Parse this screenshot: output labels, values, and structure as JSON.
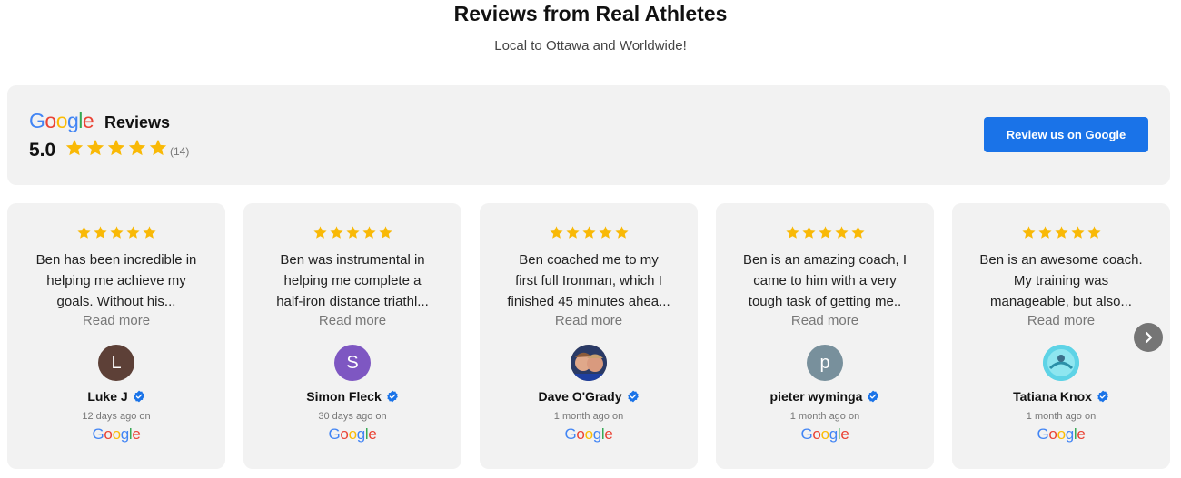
{
  "header": {
    "title": "Reviews from Real Athletes",
    "subtitle": "Local to Ottawa and Worldwide!"
  },
  "summary": {
    "logo_letters": [
      "G",
      "o",
      "o",
      "g",
      "l",
      "e"
    ],
    "reviews_label": "Reviews",
    "rating": "5.0",
    "star_count": 5,
    "review_count": "(14)",
    "button_label": "Review us on Google"
  },
  "colors": {
    "star": "#F9B906",
    "button": "#1a73e8",
    "verified": "#1a73e8",
    "google_blue": "#4285F4",
    "google_red": "#EA4335",
    "google_yellow": "#FBBC05",
    "google_green": "#34A853"
  },
  "reviews": [
    {
      "stars": 5,
      "lines": [
        "Ben has been incredible in",
        "helping me achieve my",
        "goals. Without his..."
      ],
      "read_more": "Read more",
      "avatar_letter": "L",
      "avatar_color": "#5d4037",
      "name": "Luke J",
      "time": "12 days ago on",
      "source": "Google"
    },
    {
      "stars": 5,
      "lines": [
        "Ben was instrumental in",
        "helping me complete a",
        "half-iron distance triathl..."
      ],
      "read_more": "Read more",
      "avatar_letter": "S",
      "avatar_color": "#7e57c2",
      "name": "Simon Fleck",
      "time": "30 days ago on",
      "source": "Google"
    },
    {
      "stars": 5,
      "lines": [
        "Ben coached me to my",
        "first full Ironman, which I",
        "finished 45 minutes ahea..."
      ],
      "read_more": "Read more",
      "avatar_letter": "",
      "avatar_color": "#6b5a50",
      "name": "Dave O'Grady",
      "time": "1 month ago on",
      "source": "Google"
    },
    {
      "stars": 5,
      "lines": [
        "Ben is an amazing coach, I",
        "came to him with a very",
        "tough task of getting me.."
      ],
      "read_more": "Read more",
      "avatar_letter": "p",
      "avatar_color": "#78909c",
      "name": "pieter wyminga",
      "time": "1 month ago on",
      "source": "Google"
    },
    {
      "stars": 5,
      "lines": [
        "Ben is an awesome coach.",
        "My training was",
        "manageable, but also..."
      ],
      "read_more": "Read more",
      "avatar_letter": "",
      "avatar_color": "#4dd0e1",
      "name": "Tatiana Knox",
      "time": "1 month ago on",
      "source": "Google"
    }
  ]
}
